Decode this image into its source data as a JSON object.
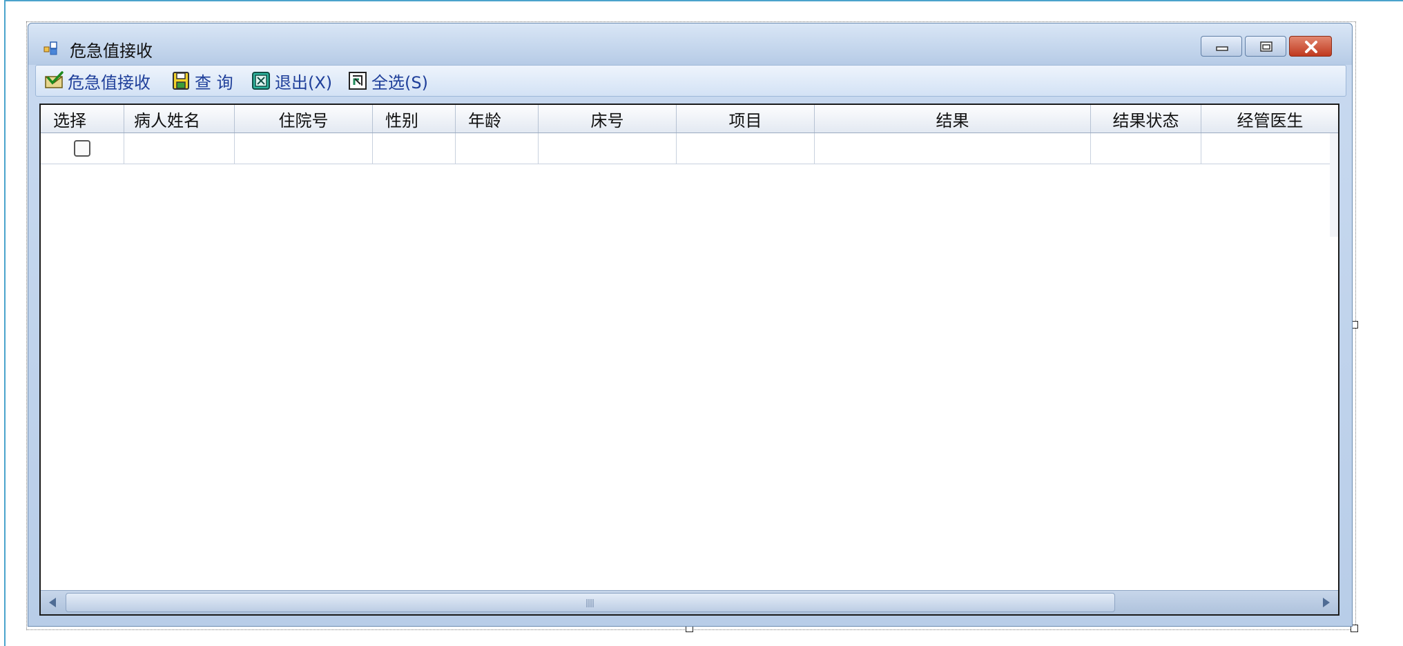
{
  "window": {
    "title": "危急值接收",
    "controls": [
      "minimize",
      "restore",
      "close"
    ]
  },
  "toolbar": {
    "buttons": [
      {
        "label": "危急值接收",
        "icon": "check-envelope-icon"
      },
      {
        "label": "查 询",
        "icon": "save-disk-icon"
      },
      {
        "label": "退出(X)",
        "icon": "exit-icon"
      },
      {
        "label": "全选(S)",
        "icon": "select-all-icon"
      }
    ]
  },
  "grid": {
    "columns": [
      "选择",
      "病人姓名",
      "住院号",
      "性别",
      "年龄",
      "床号",
      "项目",
      "结果",
      "结果状态",
      "经管医生"
    ],
    "rows": [
      {
        "checked": false,
        "cells": [
          "",
          "",
          "",
          "",
          "",
          "",
          "",
          "",
          ""
        ]
      }
    ]
  },
  "colors": {
    "accent_blue": "#1f3f9a",
    "title_gradient": "#b6cbe6",
    "close_red": "#c0391f"
  }
}
